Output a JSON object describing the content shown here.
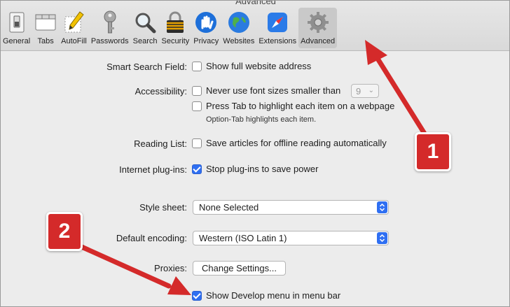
{
  "window": {
    "title": "Advanced"
  },
  "toolbar": {
    "items": [
      {
        "label": "General",
        "icon": "general-switch-icon"
      },
      {
        "label": "Tabs",
        "icon": "tabs-icon"
      },
      {
        "label": "AutoFill",
        "icon": "autofill-pencil-icon"
      },
      {
        "label": "Passwords",
        "icon": "key-icon"
      },
      {
        "label": "Search",
        "icon": "magnifier-icon"
      },
      {
        "label": "Security",
        "icon": "padlock-icon"
      },
      {
        "label": "Privacy",
        "icon": "hand-icon"
      },
      {
        "label": "Websites",
        "icon": "globe-icon"
      },
      {
        "label": "Extensions",
        "icon": "puzzle-compass-icon"
      },
      {
        "label": "Advanced",
        "icon": "gear-icon",
        "selected": true
      }
    ]
  },
  "settings": {
    "smart_search": {
      "label": "Smart Search Field:",
      "option": "Show full website address",
      "checked": false
    },
    "accessibility": {
      "label": "Accessibility:",
      "option1": "Never use font sizes smaller than",
      "font_size": "9",
      "option2": "Press Tab to highlight each item on a webpage",
      "hint": "Option-Tab highlights each item.",
      "checked1": false,
      "checked2": false
    },
    "reading_list": {
      "label": "Reading List:",
      "option": "Save articles for offline reading automatically",
      "checked": false
    },
    "plugins": {
      "label": "Internet plug-ins:",
      "option": "Stop plug-ins to save power",
      "checked": true
    },
    "style_sheet": {
      "label": "Style sheet:",
      "value": "None Selected"
    },
    "encoding": {
      "label": "Default encoding:",
      "value": "Western (ISO Latin 1)"
    },
    "proxies": {
      "label": "Proxies:",
      "button": "Change Settings..."
    },
    "develop": {
      "option": "Show Develop menu in menu bar",
      "checked": true
    }
  },
  "annotations": {
    "badge1": "1",
    "badge2": "2",
    "color": "#d42a2a"
  },
  "colors": {
    "accent": "#2f6ff2"
  }
}
